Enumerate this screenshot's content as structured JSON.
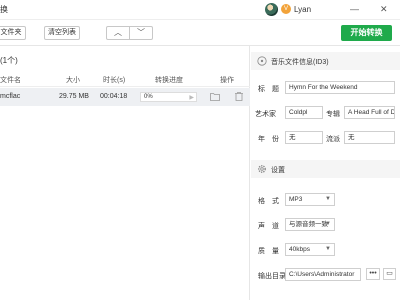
{
  "app": {
    "title": "换",
    "username": "Lyan",
    "vip_badge": "V"
  },
  "window": {
    "minimize": "—",
    "close": "✕"
  },
  "toolbar": {
    "add_folder": "文件夹",
    "clear_list": "清空列表",
    "move_up": "︿",
    "move_down": "﹀",
    "start": "开始转换",
    "accent": "#1faa4b"
  },
  "list": {
    "count_label": "(1个)",
    "columns": [
      "文件名",
      "大小",
      "时长(s)",
      "转换进度",
      "操作"
    ],
    "rows": [
      {
        "name": "mcflac",
        "size": "29.75 MB",
        "duration": "00:04:18",
        "progress": "0%"
      }
    ]
  },
  "meta": {
    "title": "音乐文件信息(ID3)",
    "title_label": "标　题",
    "title_value": "Hymn For the Weekend",
    "artist_label": "艺术家",
    "artist_value": "Coldpl",
    "album_label": "专辑",
    "album_value": "A Head Full of Dreams",
    "year_label": "年　份",
    "year_value": "无",
    "genre_label": "流派",
    "genre_value": "无"
  },
  "settings": {
    "title": "设置",
    "format_label": "格　式",
    "format_value": "MP3",
    "channel_label": "声　道",
    "channel_value": "与源音频一致",
    "quality_label": "质　量",
    "quality_value": "40kbps",
    "output_label": "输出目录",
    "output_value": "C:\\Users\\Administrator",
    "browse": "•••",
    "open_folder": "▭"
  }
}
